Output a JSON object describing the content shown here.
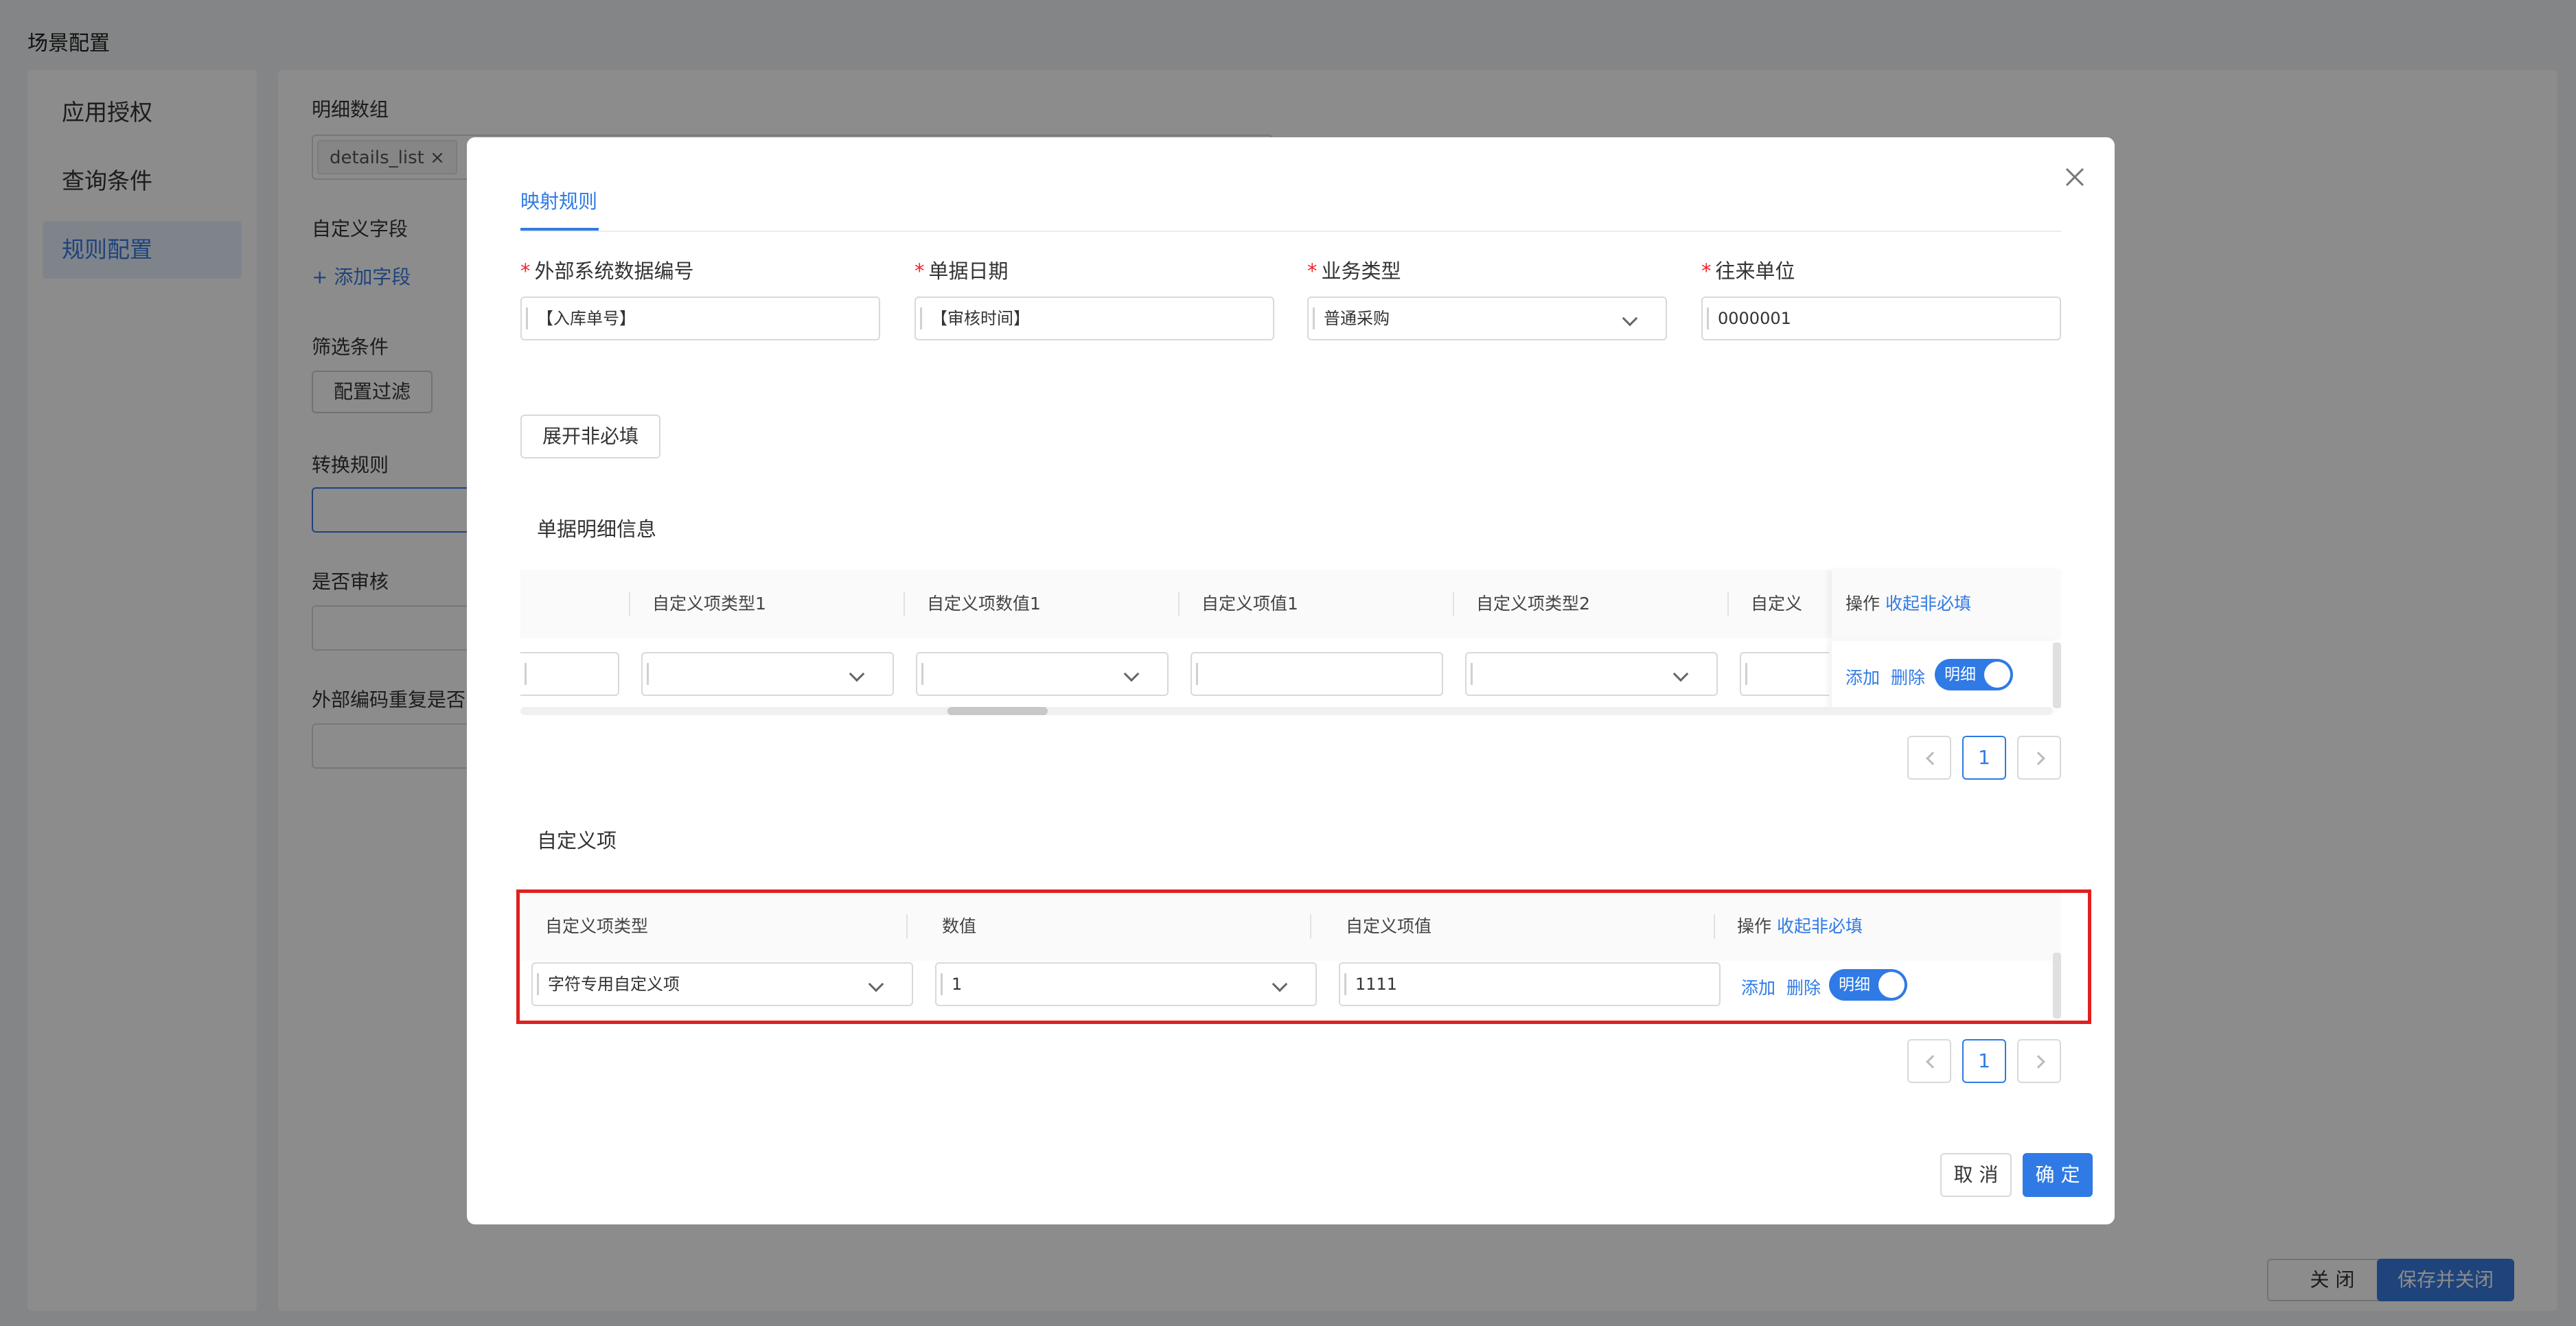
{
  "page": {
    "title": "场景配置",
    "nav": [
      "应用授权",
      "查询条件",
      "规则配置"
    ],
    "labels": {
      "details_array": "明细数组",
      "custom_field": "自定义字段",
      "add_field": "+ 添加字段",
      "filter": "筛选条件",
      "config_filter": "配置过滤",
      "convert_rule": "转换规则",
      "need_review": "是否审核",
      "ext_code_dup": "外部编码重复是否"
    },
    "details_tag": "details_list",
    "close_btn": "关 闭",
    "save_close_btn": "保存并关闭"
  },
  "modal": {
    "tab": "映射规则",
    "fields": [
      {
        "label": "外部系统数据编号",
        "value": "【入库单号】"
      },
      {
        "label": "单据日期",
        "value": "【审核时间】"
      },
      {
        "label": "业务类型",
        "value": "普通采购"
      },
      {
        "label": "往来单位",
        "value": "0000001"
      }
    ],
    "expand_btn": "展开非必填",
    "detail_section": {
      "title": "单据明细信息",
      "columns": [
        "自定义项类型1",
        "自定义项数值1",
        "自定义项值1",
        "自定义项类型2",
        "自定义项数"
      ],
      "op_label": "操作",
      "collapse": "收起非必填",
      "add": "添加",
      "delete": "删除",
      "toggle": "明细",
      "page": "1"
    },
    "custom_section": {
      "title": "自定义项",
      "columns": [
        "自定义项类型",
        "数值",
        "自定义项值"
      ],
      "op_label": "操作",
      "collapse": "收起非必填",
      "row": {
        "type": "字符专用自定义项",
        "num": "1",
        "value": "1111"
      },
      "add": "添加",
      "delete": "删除",
      "toggle": "明细",
      "page": "1"
    },
    "cancel": "取 消",
    "ok": "确 定"
  },
  "colors": {
    "accent": "#2f7ae5",
    "highlight": "#e02020",
    "required": "#f5222d"
  }
}
